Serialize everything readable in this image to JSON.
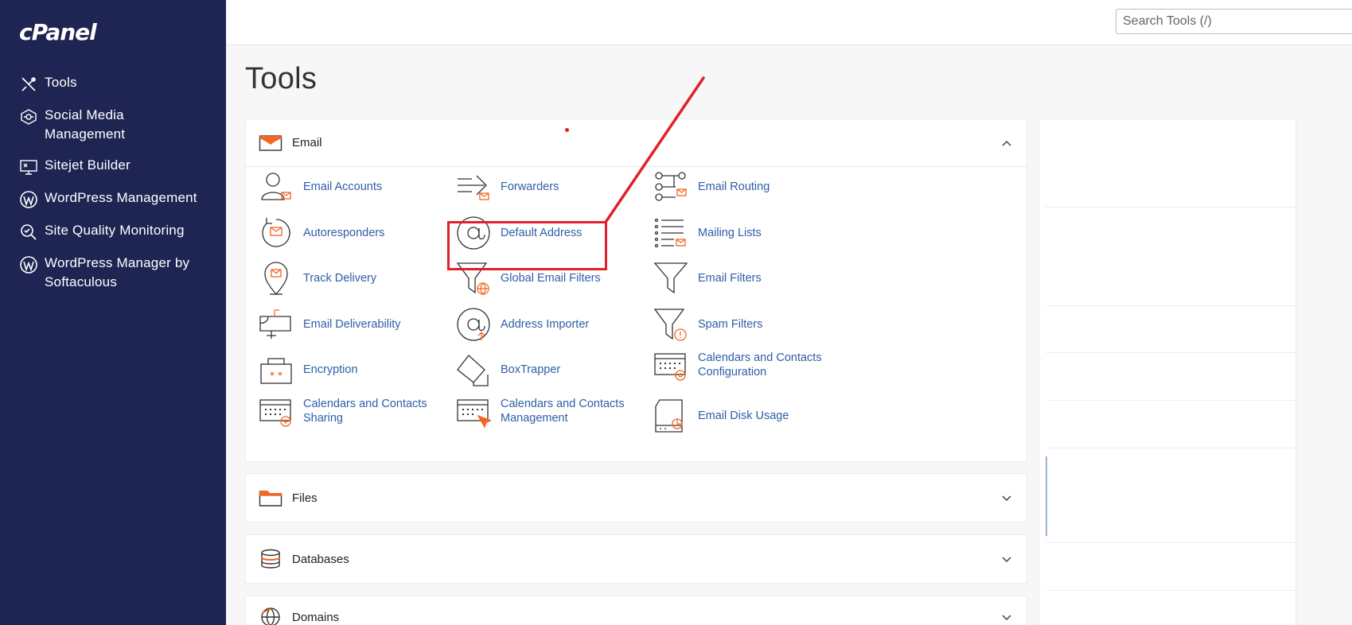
{
  "brand": {
    "logo_text": "cPanel"
  },
  "sidebar": {
    "items": [
      {
        "label": "Tools",
        "icon": "tools-icon"
      },
      {
        "label": "Social Media Management",
        "icon": "social-media-icon"
      },
      {
        "label": "Sitejet Builder",
        "icon": "sitejet-icon"
      },
      {
        "label": "WordPress Management",
        "icon": "wordpress-icon"
      },
      {
        "label": "Site Quality Monitoring",
        "icon": "site-quality-icon"
      },
      {
        "label": "WordPress Manager by Softaculous",
        "icon": "wordpress-icon"
      }
    ]
  },
  "header": {
    "search_placeholder": "Search Tools (/)"
  },
  "main": {
    "title": "Tools",
    "email": {
      "title": "Email",
      "tools": [
        {
          "label": "Email Accounts",
          "icon": "email-accounts-icon"
        },
        {
          "label": "Forwarders",
          "icon": "forwarders-icon"
        },
        {
          "label": "Email Routing",
          "icon": "email-routing-icon"
        },
        {
          "label": "Autoresponders",
          "icon": "autoresponders-icon"
        },
        {
          "label": "Default Address",
          "icon": "at-sign-icon"
        },
        {
          "label": "Mailing Lists",
          "icon": "mailing-lists-icon"
        },
        {
          "label": "Track Delivery",
          "icon": "track-delivery-icon"
        },
        {
          "label": "Global Email Filters",
          "icon": "global-filter-icon"
        },
        {
          "label": "Email Filters",
          "icon": "filter-icon"
        },
        {
          "label": "Email Deliverability",
          "icon": "mailbox-icon"
        },
        {
          "label": "Address Importer",
          "icon": "address-importer-icon"
        },
        {
          "label": "Spam Filters",
          "icon": "spam-filter-icon"
        },
        {
          "label": "Encryption",
          "icon": "encryption-icon"
        },
        {
          "label": "BoxTrapper",
          "icon": "boxtrapper-icon"
        },
        {
          "label": "Calendars and Contacts Configuration",
          "icon": "calendar-config-icon"
        },
        {
          "label": "Calendars and Contacts Sharing",
          "icon": "calendar-sharing-icon"
        },
        {
          "label": "Calendars and Contacts Management",
          "icon": "calendar-management-icon"
        },
        {
          "label": "Email Disk Usage",
          "icon": "disk-usage-icon"
        }
      ]
    },
    "files": {
      "title": "Files"
    },
    "databases": {
      "title": "Databases"
    },
    "domains": {
      "title": "Domains"
    }
  },
  "colors": {
    "sidebar_bg": "#1f2553",
    "link": "#2e5ea7",
    "accent_orange": "#f26722",
    "annotation_red": "#e0202a"
  }
}
